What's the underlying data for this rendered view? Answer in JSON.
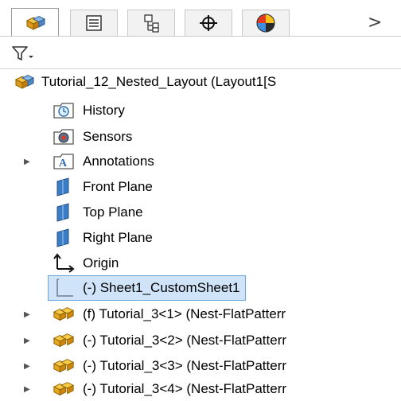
{
  "tabs": [
    {
      "name": "FeatureManager design tree",
      "icon": "assembly-icon",
      "active": true
    },
    {
      "name": "PropertyManager",
      "icon": "property-manager-icon",
      "active": false
    },
    {
      "name": "ConfigurationManager",
      "icon": "configuration-manager-icon",
      "active": false
    },
    {
      "name": "DimXpertManager",
      "icon": "dimxpert-icon",
      "active": false
    },
    {
      "name": "DisplayManager",
      "icon": "display-manager-icon",
      "active": false
    }
  ],
  "tabs_more": ">",
  "filter": {
    "icon": "filter-icon"
  },
  "tree": {
    "root": "Tutorial_12_Nested_Layout  (Layout1[S",
    "items": [
      {
        "label": "History",
        "icon": "history-icon"
      },
      {
        "label": "Sensors",
        "icon": "sensors-icon"
      },
      {
        "label": "Annotations",
        "icon": "annotations-icon"
      },
      {
        "label": "Front Plane",
        "icon": "plane-icon"
      },
      {
        "label": "Top Plane",
        "icon": "plane-icon"
      },
      {
        "label": "Right Plane",
        "icon": "plane-icon"
      },
      {
        "label": "Origin",
        "icon": "origin-icon"
      },
      {
        "label": "(-) Sheet1_CustomSheet1",
        "icon": "sheet-icon",
        "selected": true
      },
      {
        "label": "(f) Tutorial_3<1> (Nest-FlatPatterr",
        "icon": "component-icon"
      },
      {
        "label": "(-) Tutorial_3<2> (Nest-FlatPatterr",
        "icon": "component-icon"
      },
      {
        "label": "(-) Tutorial_3<3> (Nest-FlatPatterr",
        "icon": "component-icon"
      },
      {
        "label": "(-) Tutorial_3<4> (Nest-FlatPatterr",
        "icon": "component-icon"
      }
    ]
  },
  "colors": {
    "selection": "#cfe4f8",
    "selection_border": "#6aa7dc",
    "component": "#f0b020",
    "plane": "#2f6fb5"
  }
}
